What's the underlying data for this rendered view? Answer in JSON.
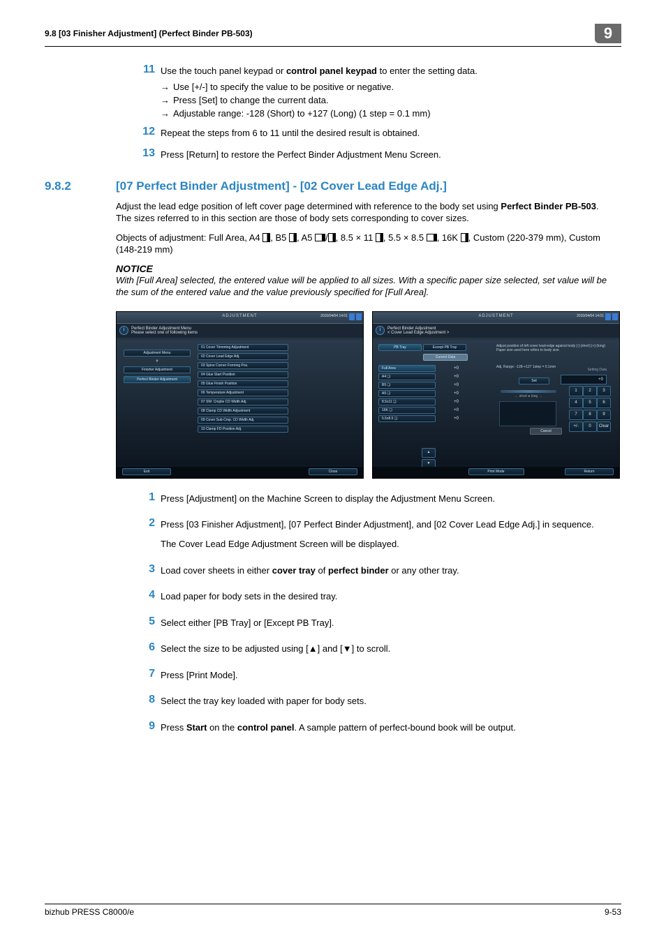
{
  "header": {
    "section_label": "9.8    [03 Finisher Adjustment] (Perfect Binder PB-503)",
    "chapter_number": "9"
  },
  "top_steps": {
    "s11": {
      "num": "11",
      "text_a": "Use the touch panel keypad or ",
      "text_b": "control panel keypad",
      "text_c": " to enter the setting data.",
      "b1": "Use [+/-] to specify the value to be positive or negative.",
      "b2": "Press [Set] to change the current data.",
      "b3": "Adjustable range: -128 (Short) to +127 (Long) (1 step = 0.1 mm)"
    },
    "s12": {
      "num": "12",
      "text": "Repeat the steps from 6 to 11 until the desired result is obtained."
    },
    "s13": {
      "num": "13",
      "text": "Press [Return] to restore the Perfect Binder Adjustment Menu Screen."
    }
  },
  "section": {
    "num": "9.8.2",
    "title": "[07 Perfect Binder Adjustment] - [02 Cover Lead Edge Adj.]"
  },
  "para1_a": "Adjust the lead edge position of left cover page determined with reference to the body set using ",
  "para1_b": "Perfect Binder PB-503",
  "para1_c": ". The sizes referred to in this section are those of body sets corresponding to cover sizes.",
  "para2": "Objects of adjustment: Full Area, A4 ❏, B5 ❏, A5 ❏/❏, 8.5 × 11 ❏, 5.5 × 8.5 ❏, 16K ❏, Custom (220-379 mm), Custom (148-219 mm)",
  "notice": {
    "head": "NOTICE",
    "body": "With [Full Area] selected, the entered value will be applied to all sizes. With a specific paper size selected, set value will be the sum of the entered value and the value previously specified for [Full Area]."
  },
  "screens": {
    "date": "2010/04/04 14:01",
    "left": {
      "info": "Perfect Binder Adjustment Menu\nPlease select one of following items",
      "leftcol": [
        "Adjustment Menu",
        "▼",
        "Finisher Adjustment",
        "Perfect Binder Adjustment"
      ],
      "rightcol": [
        "01 Cover Trimming Adjustment",
        "02 Cover Lead Edge Adj.",
        "03 Spine Corner Forming Pos.",
        "04 Glue Start Position",
        "05 Glue Finish Position",
        "06 Temperature Adjustment",
        "07 SW: Cmplie CD Width Adj.",
        "08 Clamp CD Width Adjustment",
        "09 Cover Sub-Cmp. CD Width Adj.",
        "10 Clamp FD Position Adj."
      ],
      "exit": "Exit",
      "close": "Close"
    },
    "right": {
      "info": "Perfect Binder Adjustment\n< Cover Lead Edge Adjustment >",
      "subtabs": [
        "PB Tray",
        "Except PB Tray"
      ],
      "current_tab": "Current Data",
      "instr": "Adjust position of left cover lead-edge against body [-] (short) [+] (long)\nPaper size used here refers to body size.",
      "range": "Adj. Range: -128-+127 1step = 0.1mm",
      "sizes": [
        {
          "name": "Full Area",
          "val": "+0"
        },
        {
          "name": "A4 ❏",
          "val": "+0"
        },
        {
          "name": "B5 ❏",
          "val": "+0"
        },
        {
          "name": "A5 ❏",
          "val": "+0"
        },
        {
          "name": "8.5x11 ❏",
          "val": "+0"
        },
        {
          "name": "16K ❏",
          "val": "+0"
        },
        {
          "name": "5.5x8.5 ❏",
          "val": "+0"
        }
      ],
      "set": "Set",
      "readout": "+0",
      "readlabel": "Setting Data",
      "keypad": [
        "1",
        "2",
        "3",
        "4",
        "5",
        "6",
        "7",
        "8",
        "9",
        "+/-",
        "0",
        "Clear"
      ],
      "arrows": [
        "▲",
        "▼"
      ],
      "cancel": "Cancel",
      "scale_label": "← short ● long →",
      "print_mode": "Print Mode",
      "ret": "Return"
    }
  },
  "steps2": {
    "s1": {
      "num": "1",
      "text": "Press [Adjustment] on the Machine Screen to display the Adjustment Menu Screen."
    },
    "s2": {
      "num": "2",
      "text": "Press [03 Finisher Adjustment], [07 Perfect Binder Adjustment], and [02 Cover Lead Edge Adj.] in sequence.",
      "after": "The Cover Lead Edge Adjustment Screen will be displayed."
    },
    "s3a": {
      "num": "3",
      "text_a": "Load cover sheets in either ",
      "text_b": "cover tray",
      "text_c": " of ",
      "text_d": "perfect binder",
      "text_e": " or any other tray."
    },
    "s4": {
      "num": "4",
      "text": "Load paper for body sets in the desired tray."
    },
    "s5": {
      "num": "5",
      "text": "Select either [PB Tray] or [Except PB Tray]."
    },
    "s6": {
      "num": "6",
      "text": "Select the size to be adjusted using [▲] and [▼] to scroll."
    },
    "s7": {
      "num": "7",
      "text": "Press [Print Mode]."
    },
    "s8": {
      "num": "8",
      "text": "Select the tray key loaded with paper for body sets."
    },
    "s9a": {
      "num": "9",
      "text_a": "Press ",
      "text_b": "Start",
      "text_c": " on the ",
      "text_d": "control panel",
      "text_e": ". A sample pattern of perfect-bound book will be output."
    }
  },
  "footer": {
    "product": "bizhub PRESS C8000/e",
    "page": "9-53"
  }
}
